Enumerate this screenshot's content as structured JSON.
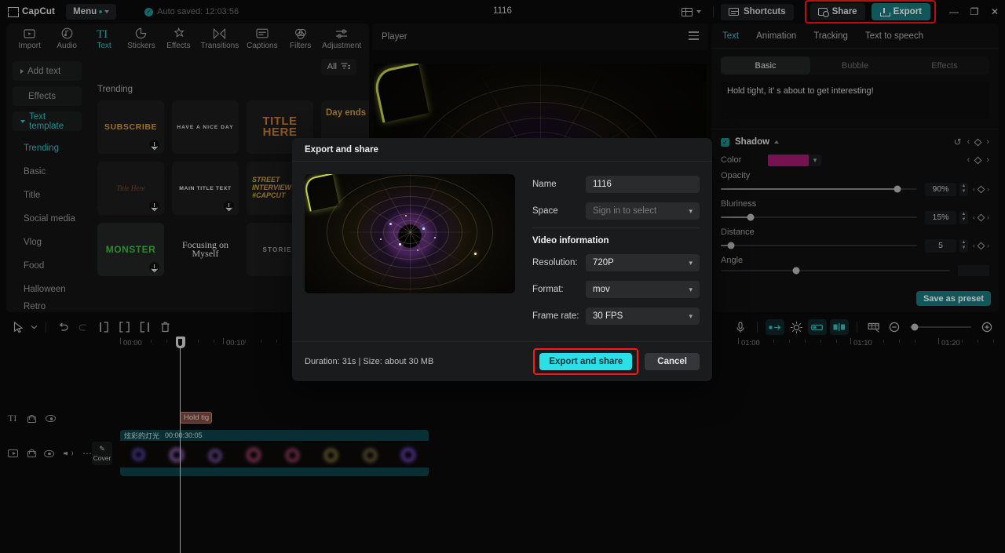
{
  "titlebar": {
    "app_name": "CapCut",
    "menu_label": "Menu",
    "autosave_text": "Auto saved: 12:03:56",
    "project_title": "1116",
    "shortcuts_label": "Shortcuts",
    "share_label": "Share",
    "export_label": "Export",
    "minimize": "—",
    "maximize": "❐",
    "close": "✕",
    "highlight_color": "#ff1616",
    "export_bg": "#18787c"
  },
  "tool_tabs": [
    {
      "label": "Import",
      "icon": "import-icon",
      "active": false
    },
    {
      "label": "Audio",
      "icon": "audio-icon",
      "active": false
    },
    {
      "label": "Text",
      "icon": "text-icon",
      "active": true
    },
    {
      "label": "Stickers",
      "icon": "stickers-icon",
      "active": false
    },
    {
      "label": "Effects",
      "icon": "effects-icon",
      "active": false
    },
    {
      "label": "Transitions",
      "icon": "transitions-icon",
      "active": false
    },
    {
      "label": "Captions",
      "icon": "captions-icon",
      "active": false
    },
    {
      "label": "Filters",
      "icon": "filters-icon",
      "active": false
    },
    {
      "label": "Adjustment",
      "icon": "adjustment-icon",
      "active": false
    }
  ],
  "sidebar": {
    "top_items": [
      {
        "label": "Add text",
        "style": "boxed-collapsed"
      },
      {
        "label": "Effects",
        "style": "boxed"
      },
      {
        "label": "Text template",
        "style": "boxed-expanded-accent"
      }
    ],
    "sub_items": [
      {
        "label": "Trending",
        "active": true
      },
      {
        "label": "Basic",
        "active": false
      },
      {
        "label": "Title",
        "active": false
      },
      {
        "label": "Social media",
        "active": false
      },
      {
        "label": "Vlog",
        "active": false
      },
      {
        "label": "Food",
        "active": false
      },
      {
        "label": "Halloween",
        "active": false
      },
      {
        "label": "Retro",
        "active": false
      }
    ]
  },
  "library": {
    "filter_label": "All",
    "section_title": "Trending",
    "templates": [
      {
        "text": "SUBSCRIBE",
        "style": "subscribe",
        "download": true
      },
      {
        "text": "HAVE A NICE DAY",
        "style": "nice",
        "download": false
      },
      {
        "text": "TITLE HERE",
        "style": "titlehere",
        "download": true
      },
      {
        "text": "Day ends",
        "style": "dayends",
        "download": false
      },
      {
        "text": "Title Here",
        "style": "script",
        "download": true
      },
      {
        "text": "MAIN TITLE TEXT",
        "style": "main",
        "download": true
      },
      {
        "text": "STREET INTERVIEW #CAPCUT",
        "style": "street",
        "download": true
      },
      {
        "text": "MONSTER",
        "style": "monster",
        "download": true
      },
      {
        "text": "Focusing on Myself",
        "style": "focus",
        "download": false
      },
      {
        "text": "STORIES",
        "style": "stories",
        "download": true
      }
    ]
  },
  "player": {
    "title": "Player"
  },
  "right_panel": {
    "tabs": [
      {
        "label": "Text",
        "active": true
      },
      {
        "label": "Animation",
        "active": false
      },
      {
        "label": "Tracking",
        "active": false
      },
      {
        "label": "Text to speech",
        "active": false
      }
    ],
    "segments": [
      {
        "label": "Basic",
        "active": true
      },
      {
        "label": "Bubble",
        "active": false
      },
      {
        "label": "Effects",
        "active": false
      }
    ],
    "text_content": "Hold tight, it’ s about to get interesting!",
    "shadow": {
      "title": "Shadow",
      "enabled": true,
      "color_label": "Color",
      "color_value": "#a31a6e",
      "opacity_label": "Opacity",
      "opacity_value": "90%",
      "opacity_pct": 90,
      "bluriness_label": "Bluriness",
      "bluriness_value": "15%",
      "bluriness_pct": 15,
      "distance_label": "Distance",
      "distance_value": "5",
      "distance_pct": 5,
      "angle_label": "Angle"
    },
    "save_preset_label": "Save as preset"
  },
  "timeline": {
    "ruler_labels": [
      "00:00",
      "00:10",
      "01:00",
      "01:10",
      "01:20"
    ],
    "cover_label": "Cover",
    "text_clip_label": "Hold tig",
    "video_clip_name": "炫彩的灯光",
    "video_clip_duration": "00:00:30:05"
  },
  "dialog": {
    "title": "Export and share",
    "name_label": "Name",
    "name_value": "1116",
    "space_label": "Space",
    "space_value": "Sign in to select",
    "video_info_title": "Video information",
    "resolution_label": "Resolution:",
    "resolution_value": "720P",
    "format_label": "Format:",
    "format_value": "mov",
    "framerate_label": "Frame rate:",
    "framerate_value": "30 FPS",
    "duration_text": "Duration: 31s | Size: about 30 MB",
    "export_button": "Export and share",
    "cancel_button": "Cancel",
    "export_button_color": "#2ae0e6",
    "highlight_color": "#ff1616"
  }
}
